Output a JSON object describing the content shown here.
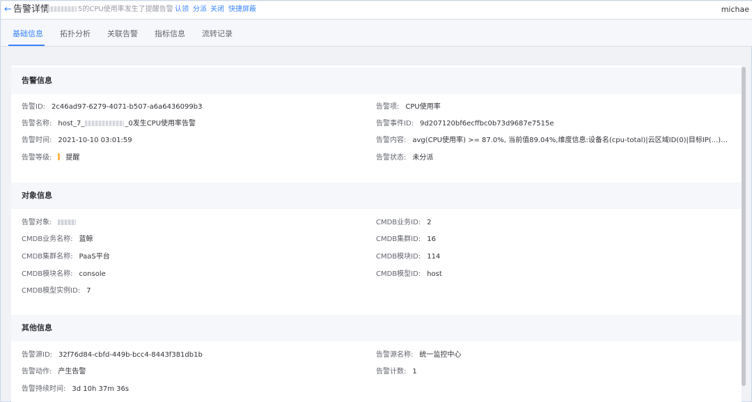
{
  "header": {
    "back_icon": "←",
    "title": "告警详情",
    "subtitle": "5的CPU使用率发生了提醒告警",
    "actions": [
      "认领",
      "分派",
      "关闭",
      "快捷屏蔽"
    ],
    "user": "michae"
  },
  "tabs": [
    "基础信息",
    "拓扑分析",
    "关联告警",
    "指标信息",
    "流转记录"
  ],
  "active_tab": "基础信息",
  "sections": {
    "alert": {
      "title": "告警信息",
      "left": [
        {
          "label": "告警ID:",
          "value": "2c46ad97-6279-4071-b507-a6a6436099b3"
        },
        {
          "label": "告警名称:",
          "value_pre": "host_7_",
          "value_post": "_0发生CPU使用率告警"
        },
        {
          "label": "告警时间:",
          "value": "2021-10-10 03:01:59"
        },
        {
          "label": "告警等级:",
          "value": "提醒"
        }
      ],
      "right": [
        {
          "label": "告警项:",
          "value": "CPU使用率"
        },
        {
          "label": "告警事件ID:",
          "value": "9d207120bf6ecffbc0b73d9687e7515e"
        },
        {
          "label": "告警内容:",
          "value": "avg(CPU使用率) >= 87.0%, 当前值89.04%,维度信息:设备名(cpu-total)|云区域ID(0)|目标IP(...)|..."
        },
        {
          "label": "告警状态:",
          "value": "未分派"
        }
      ]
    },
    "object": {
      "title": "对象信息",
      "left": [
        {
          "label": "告警对象:",
          "value": ""
        },
        {
          "label": "CMDB业务名称:",
          "value": "蓝鲸"
        },
        {
          "label": "CMDB集群名称:",
          "value": "PaaS平台"
        },
        {
          "label": "CMDB模块名称:",
          "value": "console"
        },
        {
          "label": "CMDB模型实例ID:",
          "value": "7"
        }
      ],
      "right": [
        {
          "label": "CMDB业务ID:",
          "value": "2"
        },
        {
          "label": "CMDB集群ID:",
          "value": "16"
        },
        {
          "label": "CMDB模块ID:",
          "value": "114"
        },
        {
          "label": "CMDB模型ID:",
          "value": "host"
        }
      ]
    },
    "other": {
      "title": "其他信息",
      "left": [
        {
          "label": "告警源ID:",
          "value": "32f76d84-cbfd-449b-bcc4-8443f381db1b"
        },
        {
          "label": "告警动作:",
          "value": "产生告警"
        },
        {
          "label": "告警持续时间:",
          "value": "3d 10h 37m 36s"
        }
      ],
      "right": [
        {
          "label": "告警源名称:",
          "value": "统一监控中心"
        },
        {
          "label": "告警计数:",
          "value": "1"
        }
      ]
    }
  },
  "colors": {
    "accent": "#3a84ff",
    "level_warning": "#ffb848"
  }
}
